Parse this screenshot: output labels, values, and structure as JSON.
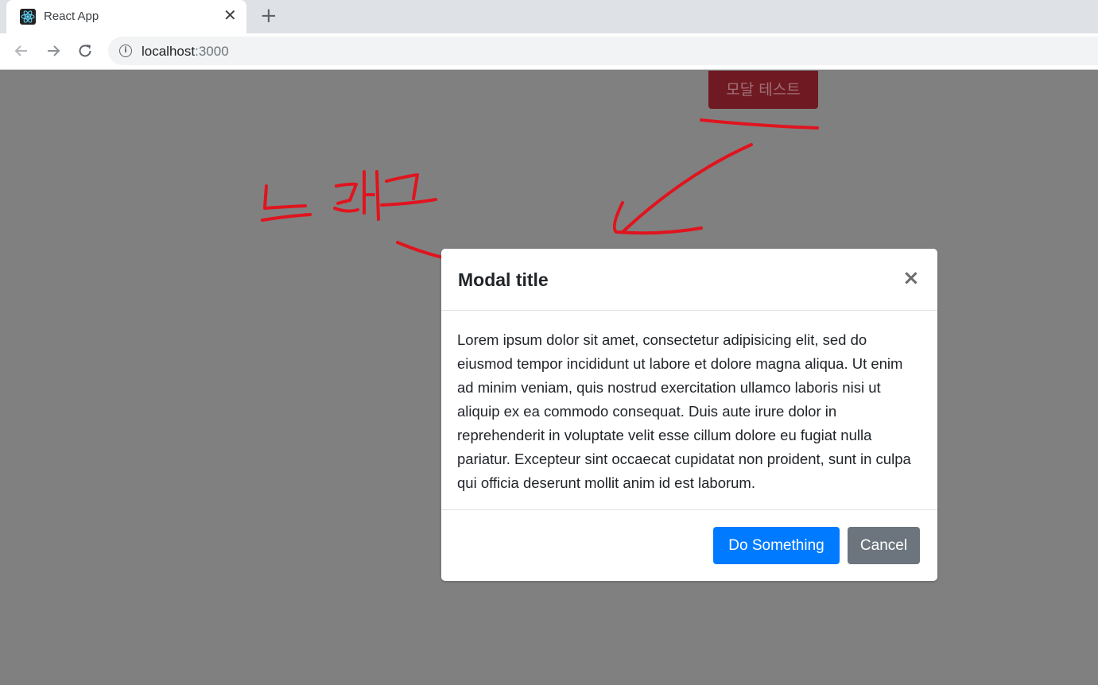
{
  "browser": {
    "tab_title": "React App",
    "tab_close": "✕",
    "new_tab": "+",
    "url_host": "localhost",
    "url_port": ":3000",
    "icons": {
      "favicon": "react-icon",
      "back": "arrow-left-icon",
      "forward": "arrow-right-icon",
      "reload": "reload-icon",
      "info": "info-icon"
    }
  },
  "page": {
    "test_button_label": "모달 테스트"
  },
  "annotation": {
    "drag_text": "드래그",
    "color": "#e0141e"
  },
  "modal": {
    "title": "Modal title",
    "close": "×",
    "body": "Lorem ipsum dolor sit amet, consectetur adipisicing elit, sed do eiusmod tempor incididunt ut labore et dolore magna aliqua. Ut enim ad minim veniam, quis nostrud exercitation ullamco laboris nisi ut aliquip ex ea commodo consequat. Duis aute irure dolor in reprehenderit in voluptate velit esse cillum dolore eu fugiat nulla pariatur. Excepteur sint occaecat cupidatat non proident, sunt in culpa qui officia deserunt mollit anim id est laborum.",
    "primary_label": "Do Something",
    "secondary_label": "Cancel",
    "colors": {
      "primary": "#007bff",
      "secondary": "#6c757d"
    }
  }
}
